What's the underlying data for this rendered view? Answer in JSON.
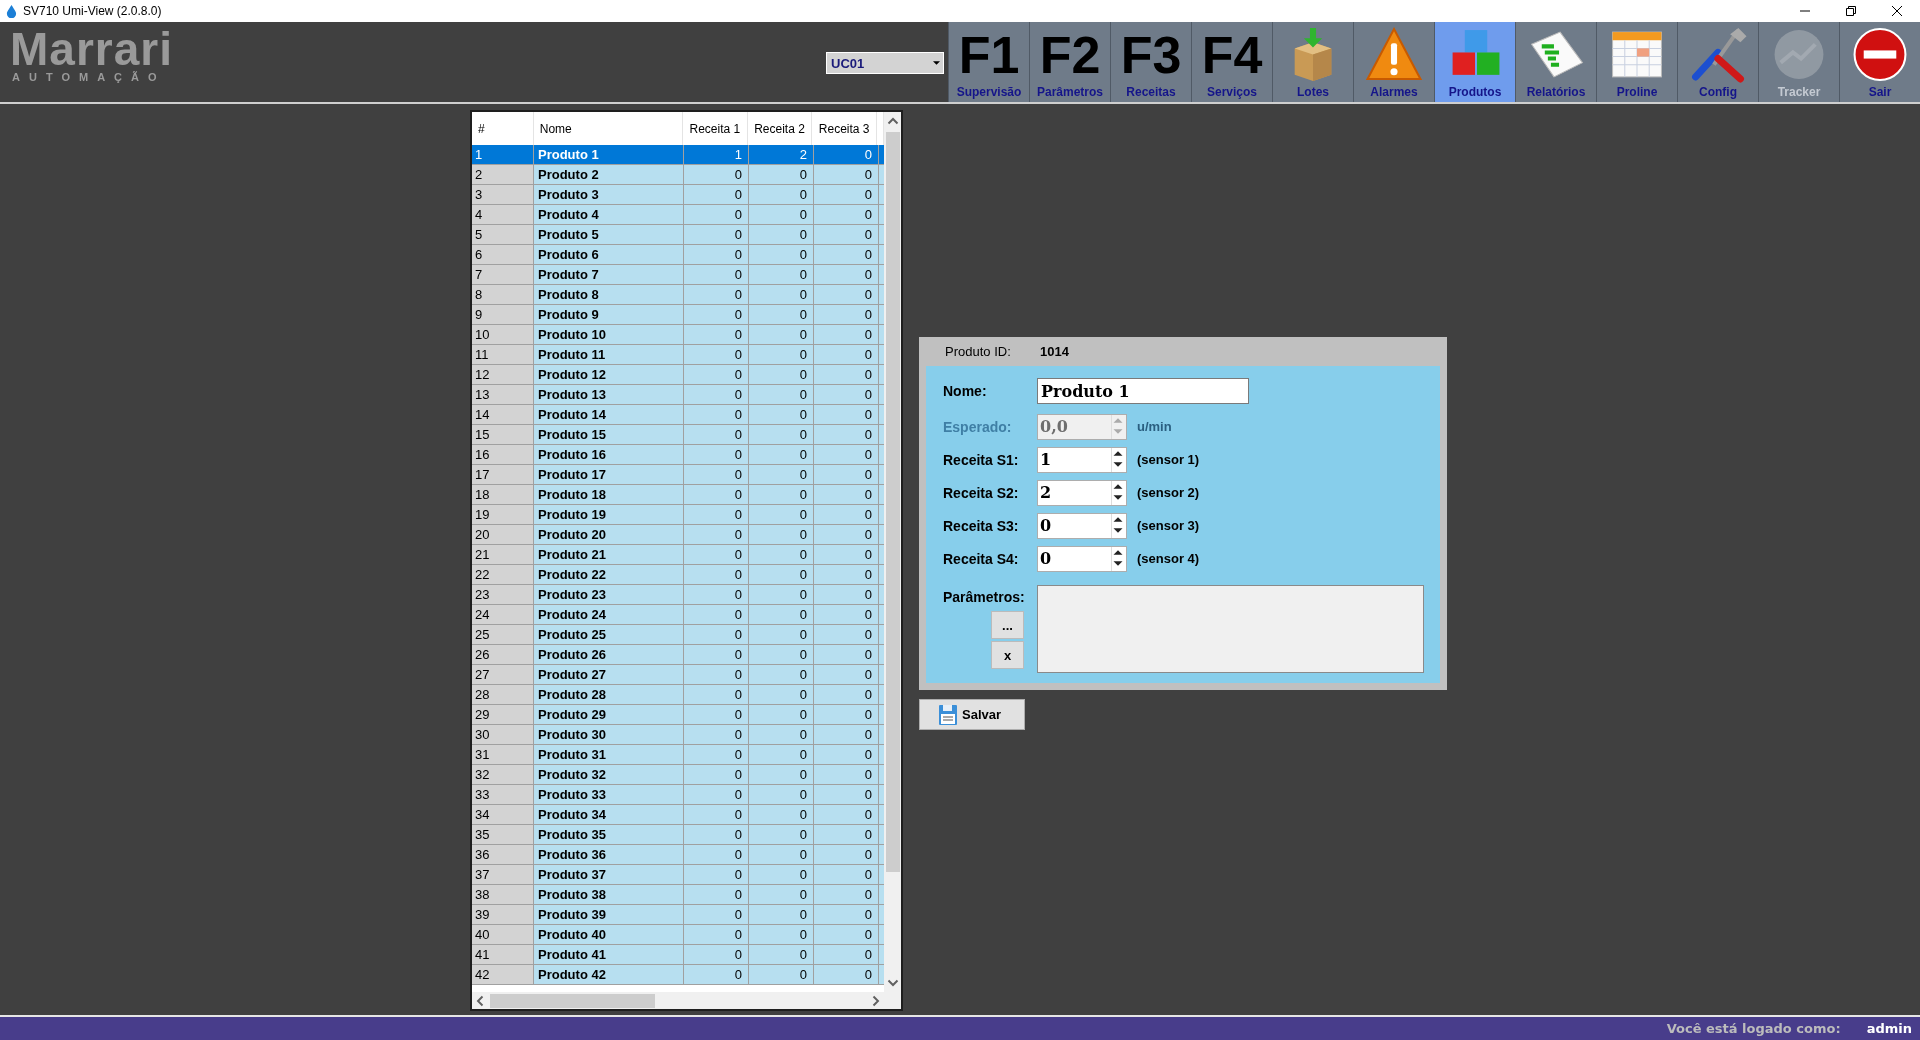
{
  "window": {
    "title": "SV710 Umi-View (2.0.8.0)"
  },
  "logo": {
    "name": "Marrari",
    "tagline": "AUTOMAÇÃO"
  },
  "unit_select": {
    "value": "UC01"
  },
  "toolbar": [
    {
      "kind": "key",
      "key": "F1",
      "label": "Supervisão",
      "selected": false,
      "disabled": false
    },
    {
      "kind": "key",
      "key": "F2",
      "label": "Parâmetros",
      "selected": false,
      "disabled": false
    },
    {
      "kind": "key",
      "key": "F3",
      "label": "Receitas",
      "selected": false,
      "disabled": false
    },
    {
      "kind": "key",
      "key": "F4",
      "label": "Serviços",
      "selected": false,
      "disabled": false
    },
    {
      "kind": "icon",
      "label": "Lotes",
      "selected": false,
      "disabled": false
    },
    {
      "kind": "icon",
      "label": "Alarmes",
      "selected": false,
      "disabled": false
    },
    {
      "kind": "icon",
      "label": "Produtos",
      "selected": true,
      "disabled": false
    },
    {
      "kind": "icon",
      "label": "Relatórios",
      "selected": false,
      "disabled": false
    },
    {
      "kind": "icon",
      "label": "Proline",
      "selected": false,
      "disabled": false
    },
    {
      "kind": "icon",
      "label": "Config",
      "selected": false,
      "disabled": false
    },
    {
      "kind": "icon",
      "label": "Tracker",
      "selected": false,
      "disabled": true
    },
    {
      "kind": "icon",
      "label": "Sair",
      "selected": false,
      "disabled": false
    }
  ],
  "table": {
    "columns": [
      "#",
      "Nome",
      "Receita 1",
      "Receita 2",
      "Receita 3"
    ],
    "rows": [
      {
        "num": "1",
        "name": "Produto 1",
        "values": [
          "1",
          "2",
          "0"
        ],
        "selected": true
      },
      {
        "num": "2",
        "name": "Produto 2",
        "values": [
          "0",
          "0",
          "0"
        ],
        "selected": false
      },
      {
        "num": "3",
        "name": "Produto 3",
        "values": [
          "0",
          "0",
          "0"
        ],
        "selected": false
      },
      {
        "num": "4",
        "name": "Produto 4",
        "values": [
          "0",
          "0",
          "0"
        ],
        "selected": false
      },
      {
        "num": "5",
        "name": "Produto 5",
        "values": [
          "0",
          "0",
          "0"
        ],
        "selected": false
      },
      {
        "num": "6",
        "name": "Produto 6",
        "values": [
          "0",
          "0",
          "0"
        ],
        "selected": false
      },
      {
        "num": "7",
        "name": "Produto 7",
        "values": [
          "0",
          "0",
          "0"
        ],
        "selected": false
      },
      {
        "num": "8",
        "name": "Produto 8",
        "values": [
          "0",
          "0",
          "0"
        ],
        "selected": false
      },
      {
        "num": "9",
        "name": "Produto 9",
        "values": [
          "0",
          "0",
          "0"
        ],
        "selected": false
      },
      {
        "num": "10",
        "name": "Produto 10",
        "values": [
          "0",
          "0",
          "0"
        ],
        "selected": false
      },
      {
        "num": "11",
        "name": "Produto 11",
        "values": [
          "0",
          "0",
          "0"
        ],
        "selected": false
      },
      {
        "num": "12",
        "name": "Produto 12",
        "values": [
          "0",
          "0",
          "0"
        ],
        "selected": false
      },
      {
        "num": "13",
        "name": "Produto 13",
        "values": [
          "0",
          "0",
          "0"
        ],
        "selected": false
      },
      {
        "num": "14",
        "name": "Produto 14",
        "values": [
          "0",
          "0",
          "0"
        ],
        "selected": false
      },
      {
        "num": "15",
        "name": "Produto 15",
        "values": [
          "0",
          "0",
          "0"
        ],
        "selected": false
      },
      {
        "num": "16",
        "name": "Produto 16",
        "values": [
          "0",
          "0",
          "0"
        ],
        "selected": false
      },
      {
        "num": "17",
        "name": "Produto 17",
        "values": [
          "0",
          "0",
          "0"
        ],
        "selected": false
      },
      {
        "num": "18",
        "name": "Produto 18",
        "values": [
          "0",
          "0",
          "0"
        ],
        "selected": false
      },
      {
        "num": "19",
        "name": "Produto 19",
        "values": [
          "0",
          "0",
          "0"
        ],
        "selected": false
      },
      {
        "num": "20",
        "name": "Produto 20",
        "values": [
          "0",
          "0",
          "0"
        ],
        "selected": false
      },
      {
        "num": "21",
        "name": "Produto 21",
        "values": [
          "0",
          "0",
          "0"
        ],
        "selected": false
      },
      {
        "num": "22",
        "name": "Produto 22",
        "values": [
          "0",
          "0",
          "0"
        ],
        "selected": false
      },
      {
        "num": "23",
        "name": "Produto 23",
        "values": [
          "0",
          "0",
          "0"
        ],
        "selected": false
      },
      {
        "num": "24",
        "name": "Produto 24",
        "values": [
          "0",
          "0",
          "0"
        ],
        "selected": false
      },
      {
        "num": "25",
        "name": "Produto 25",
        "values": [
          "0",
          "0",
          "0"
        ],
        "selected": false
      },
      {
        "num": "26",
        "name": "Produto 26",
        "values": [
          "0",
          "0",
          "0"
        ],
        "selected": false
      },
      {
        "num": "27",
        "name": "Produto 27",
        "values": [
          "0",
          "0",
          "0"
        ],
        "selected": false
      },
      {
        "num": "28",
        "name": "Produto 28",
        "values": [
          "0",
          "0",
          "0"
        ],
        "selected": false
      },
      {
        "num": "29",
        "name": "Produto 29",
        "values": [
          "0",
          "0",
          "0"
        ],
        "selected": false
      },
      {
        "num": "30",
        "name": "Produto 30",
        "values": [
          "0",
          "0",
          "0"
        ],
        "selected": false
      },
      {
        "num": "31",
        "name": "Produto 31",
        "values": [
          "0",
          "0",
          "0"
        ],
        "selected": false
      },
      {
        "num": "32",
        "name": "Produto 32",
        "values": [
          "0",
          "0",
          "0"
        ],
        "selected": false
      },
      {
        "num": "33",
        "name": "Produto 33",
        "values": [
          "0",
          "0",
          "0"
        ],
        "selected": false
      },
      {
        "num": "34",
        "name": "Produto 34",
        "values": [
          "0",
          "0",
          "0"
        ],
        "selected": false
      },
      {
        "num": "35",
        "name": "Produto 35",
        "values": [
          "0",
          "0",
          "0"
        ],
        "selected": false
      },
      {
        "num": "36",
        "name": "Produto 36",
        "values": [
          "0",
          "0",
          "0"
        ],
        "selected": false
      },
      {
        "num": "37",
        "name": "Produto 37",
        "values": [
          "0",
          "0",
          "0"
        ],
        "selected": false
      },
      {
        "num": "38",
        "name": "Produto 38",
        "values": [
          "0",
          "0",
          "0"
        ],
        "selected": false
      },
      {
        "num": "39",
        "name": "Produto 39",
        "values": [
          "0",
          "0",
          "0"
        ],
        "selected": false
      },
      {
        "num": "40",
        "name": "Produto 40",
        "values": [
          "0",
          "0",
          "0"
        ],
        "selected": false
      },
      {
        "num": "41",
        "name": "Produto 41",
        "values": [
          "0",
          "0",
          "0"
        ],
        "selected": false
      },
      {
        "num": "42",
        "name": "Produto 42",
        "values": [
          "0",
          "0",
          "0"
        ],
        "selected": false
      }
    ]
  },
  "form": {
    "id_label": "Produto ID:",
    "id_value": "1014",
    "fields": [
      {
        "kind": "text",
        "label": "Nome:",
        "value": "Produto 1",
        "disabled": false
      },
      {
        "kind": "spinner",
        "label": "Esperado:",
        "value": "0,0",
        "unit": "u/min",
        "disabled": true
      },
      {
        "kind": "spinner",
        "label": "Receita S1:",
        "value": "1",
        "unit": "(sensor 1)",
        "disabled": false
      },
      {
        "kind": "spinner",
        "label": "Receita S2:",
        "value": "2",
        "unit": "(sensor 2)",
        "disabled": false
      },
      {
        "kind": "spinner",
        "label": "Receita S3:",
        "value": "0",
        "unit": "(sensor 3)",
        "disabled": false
      },
      {
        "kind": "spinner",
        "label": "Receita S4:",
        "value": "0",
        "unit": "(sensor 4)",
        "disabled": false
      }
    ],
    "params_label": "Parâmetros:",
    "browse_button": "...",
    "clear_button": "x"
  },
  "save_button": "Salvar",
  "status_bar": {
    "label": "Você está logado como:",
    "user": "admin"
  }
}
